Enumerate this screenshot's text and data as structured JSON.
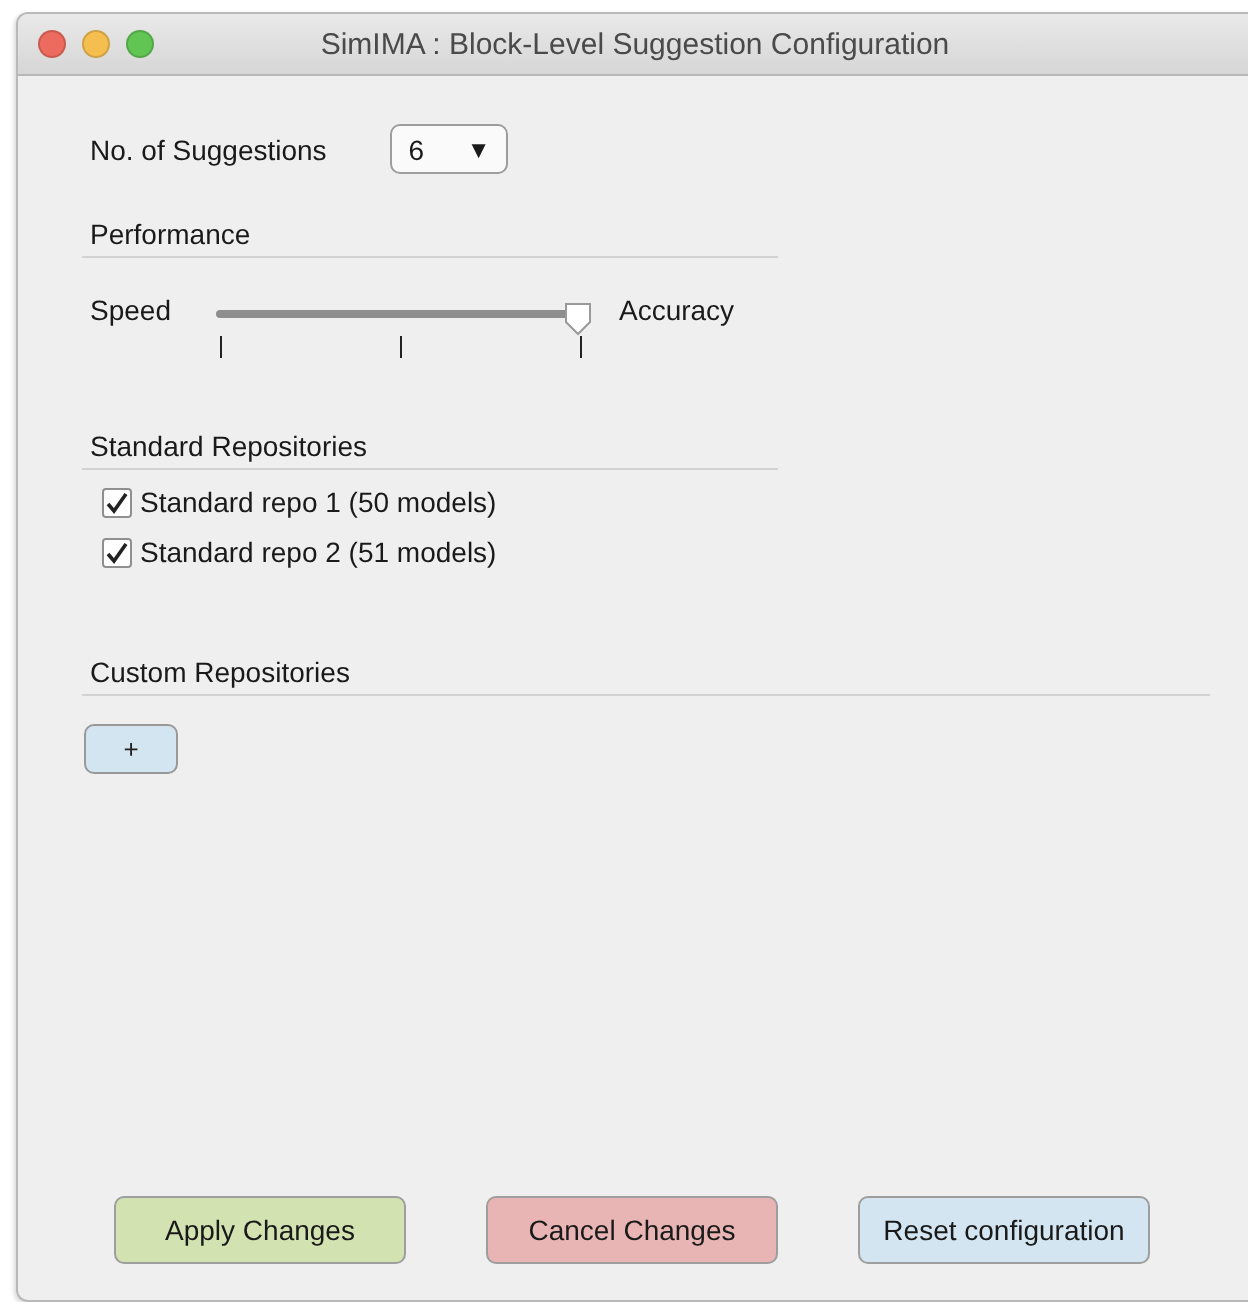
{
  "window": {
    "title": "SimIMA : Block-Level Suggestion Configuration"
  },
  "suggestions": {
    "label": "No. of Suggestions",
    "value": "6",
    "arrow": "▼"
  },
  "performance": {
    "heading": "Performance",
    "min_label": "Speed",
    "max_label": "Accuracy",
    "level": 1
  },
  "standard_repositories": {
    "heading": "Standard Repositories",
    "items": [
      {
        "label": "Standard repo 1 (50 models)",
        "checked": true
      },
      {
        "label": "Standard repo 2 (51 models)",
        "checked": true
      }
    ]
  },
  "custom_repositories": {
    "heading": "Custom Repositories",
    "add_button": "+"
  },
  "buttons": [
    {
      "label": "Apply Changes",
      "kind": "apply"
    },
    {
      "label": "Cancel Changes",
      "kind": "cancel"
    },
    {
      "label": "Reset configuration",
      "kind": "reset"
    }
  ]
}
